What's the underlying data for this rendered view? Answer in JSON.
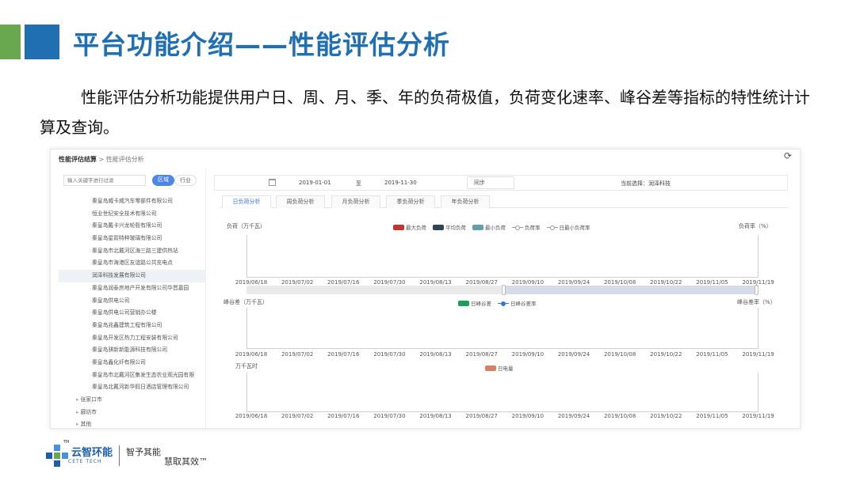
{
  "slide": {
    "title": "平台功能介绍——性能评估分析",
    "description": "性能评估分析功能提供用户日、周、月、季、年的负荷极值，负荷变化速率、峰谷差等指标的特性统计计算及查询。"
  },
  "app": {
    "breadcrumb_root": "性能评估结算",
    "breadcrumb_sep": ">",
    "breadcrumb_current": "性能评估分析",
    "refresh_icon": "refresh-icon"
  },
  "left_panel": {
    "search_placeholder": "输入关键字进行过滤",
    "btn_region": "区域",
    "btn_industry": "行业",
    "selected_index": 6,
    "items": [
      "秦皇岛威卡威汽车零部件有限公司",
      "恒业世纪安全技术有限公司",
      "秦皇岛戴卡兴龙轮毂有限公司",
      "秦皇岛星箭特种玻璃有限公司",
      "秦皇岛市北戴河区海三路三建供热站",
      "秦皇岛市海港区友谊路公共充电点",
      "润泽科技发展有限公司",
      "秦皇岛润泰房地产开发有限公司华晋嘉园",
      "秦皇岛供电公司",
      "秦皇岛供电公司营销办公楼",
      "秦皇岛兆鑫建筑工程有限公司",
      "秦皇岛开发区热力工程安装有限公司",
      "秦皇岛骐新新能源科技有限公司",
      "秦皇岛鑫化纤有限公司",
      "秦皇岛市北戴河区集发生态农业观光园有限",
      "秦皇岛北戴河新华假日酒店管理有限公司"
    ],
    "groups": [
      "张家口市",
      "廊坊市",
      "其他"
    ]
  },
  "filters": {
    "start_date": "2019-01-01",
    "to_label": "至",
    "end_date": "2019-11-30",
    "sync_label": "同步",
    "current_label": "当前选择：润泽科技"
  },
  "tabs": [
    "日负荷分析",
    "周负荷分析",
    "月负荷分析",
    "季负荷分析",
    "年负荷分析"
  ],
  "charts": {
    "load": {
      "y_left_label": "负荷（万千瓦）",
      "y_right_label": "负荷率（%）",
      "legend": [
        "最大负荷",
        "平均负荷",
        "最小负荷",
        "负荷率",
        "日最小负荷率"
      ]
    },
    "peak_valley": {
      "y_left_label": "峰谷差（万千瓦）",
      "y_right_label": "峰谷差率（%）",
      "legend": [
        "日峰谷差",
        "日峰谷差率"
      ]
    },
    "energy": {
      "y_left_label": "万千瓦时",
      "legend": [
        "日电量"
      ]
    },
    "x_ticks": [
      "2019/06/18",
      "2019/07/02",
      "2019/07/16",
      "2019/07/30",
      "2019/08/13",
      "2019/08/27",
      "2019/09/10",
      "2019/09/24",
      "2019/10/08",
      "2019/10/22",
      "2019/11/05",
      "2019/11/19"
    ],
    "slider_range": [
      0.5,
      1.0
    ]
  },
  "colors": {
    "title_blue": "#1f6fb2",
    "accent_green": "#6aa84f",
    "max_load": "#c23531",
    "avg_load": "#2f4554",
    "min_load": "#61a0a8",
    "peak_valley": "#1aa05a",
    "energy": "#d48265",
    "line_blue": "#3a76d8"
  },
  "footer": {
    "brand_cn": "云智环能",
    "brand_en": "CETE TECH",
    "tm": "TM",
    "slogan_1": "智予其能",
    "slogan_2": "慧取其效™"
  }
}
